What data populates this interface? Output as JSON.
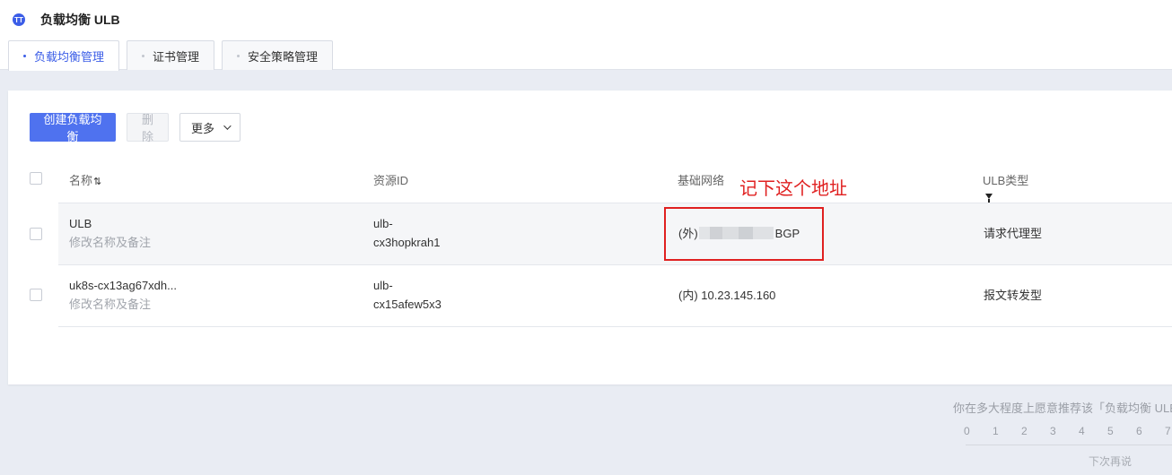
{
  "app": {
    "icon": "ulb-logo-icon",
    "icon_glyph": "TT",
    "title": "负载均衡 ULB",
    "accent": "#3b5de7"
  },
  "tabs": [
    {
      "label": "负载均衡管理",
      "active": true
    },
    {
      "label": "证书管理",
      "active": false
    },
    {
      "label": "安全策略管理",
      "active": false
    }
  ],
  "toolbar": {
    "create_label": "创建负载均衡",
    "delete_label": "删除",
    "more_label": "更多"
  },
  "table": {
    "headers": {
      "name": "名称",
      "sort_icon": "⇅",
      "resource_id": "资源ID",
      "network": "基础网络",
      "ulb_type": "ULB类型"
    },
    "rows": [
      {
        "name": "ULB",
        "remark": "修改名称及备注",
        "id_line1": "ulb-",
        "id_line2": "cx3hopkrah1",
        "net_prefix": "(外)",
        "net_suffix": "BGP",
        "type": "请求代理型"
      },
      {
        "name": "uk8s-cx13ag67xdh...",
        "remark": "修改名称及备注",
        "id_line1": "ulb-",
        "id_line2": "cx15afew5x3",
        "net_prefix": "(内) 10.23.145.160",
        "net_suffix": "",
        "type": "报文转发型"
      }
    ]
  },
  "annotation": {
    "text": "记下这个地址",
    "color": "#e02020"
  },
  "survey": {
    "question": "你在多大程度上愿意推荐该「负载均衡 ULB」产品",
    "scale": [
      "0",
      "1",
      "2",
      "3",
      "4",
      "5",
      "6",
      "7"
    ],
    "later_label": "下次再说"
  }
}
